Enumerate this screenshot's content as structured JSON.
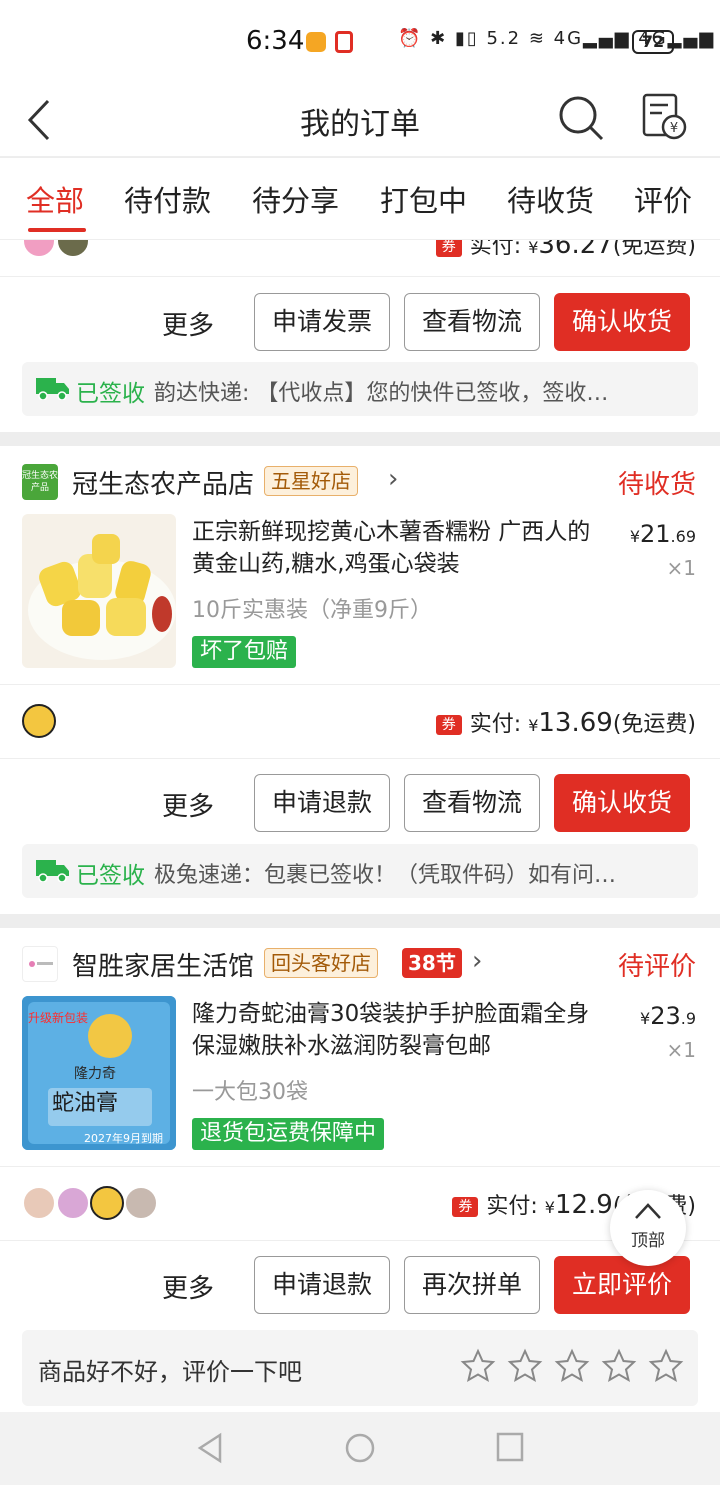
{
  "status_bar": {
    "time": "6:34",
    "network_speed": "5.2 K/s",
    "signal_icons": "⏰ ✱ ▮▯ 5.2 ≋ 4G▂▄▆ 4G▂▄▆",
    "battery": "72"
  },
  "header": {
    "title": "我的订单"
  },
  "tabs": [
    "全部",
    "待付款",
    "待分享",
    "打包中",
    "待收货",
    "评价"
  ],
  "partial_order": {
    "paid_label": "实付:",
    "paid_currency": "¥",
    "paid_amount": "36.27",
    "shipping_note": "(免运费)",
    "actions": {
      "more": "更多",
      "btn1": "申请发票",
      "btn2": "查看物流",
      "btn3": "确认收货"
    },
    "logistics": {
      "status": "已签收",
      "message": "韵达快递:  【代收点】您的快件已签收，签收…"
    }
  },
  "orders": [
    {
      "shop_name": "冠生态农产品店",
      "shop_logo_text": "冠生态农产品",
      "badge": "五星好店",
      "status": "待收货",
      "product_title": "正宗新鲜现挖黄心木薯香糯粉 广西人的黄金山药,糖水,鸡蛋心袋装",
      "spec": "10斤实惠装（净重9斤）",
      "tag": "坏了包赔",
      "price_currency": "¥",
      "price_int": "21",
      "price_dec": ".69",
      "qty": "×1",
      "paid_label": "实付:",
      "paid_currency": "¥",
      "paid_amount": "13.69",
      "shipping_note": "(免运费)",
      "actions": {
        "more": "更多",
        "btn1": "申请退款",
        "btn2": "查看物流",
        "btn3": "确认收货"
      },
      "logistics": {
        "status": "已签收",
        "message": "极兔速递：包裹已签收！（凭取件码）如有问…"
      }
    },
    {
      "shop_name": "智胜家居生活馆",
      "badge": "回头客好店",
      "festival_badge": "38节",
      "status": "待评价",
      "product_title": "隆力奇蛇油膏30袋装护手护脸面霜全身保湿嫩肤补水滋润防裂膏包邮",
      "spec": "一大包30袋",
      "tag": "退货包运费保障中",
      "image_text": {
        "top": "升级新包装",
        "brand": "隆力奇",
        "name": "蛇油膏",
        "expiry": "2027年9月到期"
      },
      "price_currency": "¥",
      "price_int": "23",
      "price_dec": ".9",
      "qty": "×1",
      "paid_label": "实付:",
      "paid_currency": "¥",
      "paid_amount": "12.9",
      "shipping_note": "(免运费)",
      "actions": {
        "more": "更多",
        "btn1": "申请退款",
        "btn2": "再次拼单",
        "btn3": "立即评价"
      },
      "rating_prompt": "商品好不好，评价一下吧",
      "rating_stars": 5
    }
  ],
  "back_to_top": "顶部",
  "colors": {
    "brand_red": "#e02e24",
    "success_green": "#2bb24c",
    "badge_gold": "#a35a08"
  }
}
